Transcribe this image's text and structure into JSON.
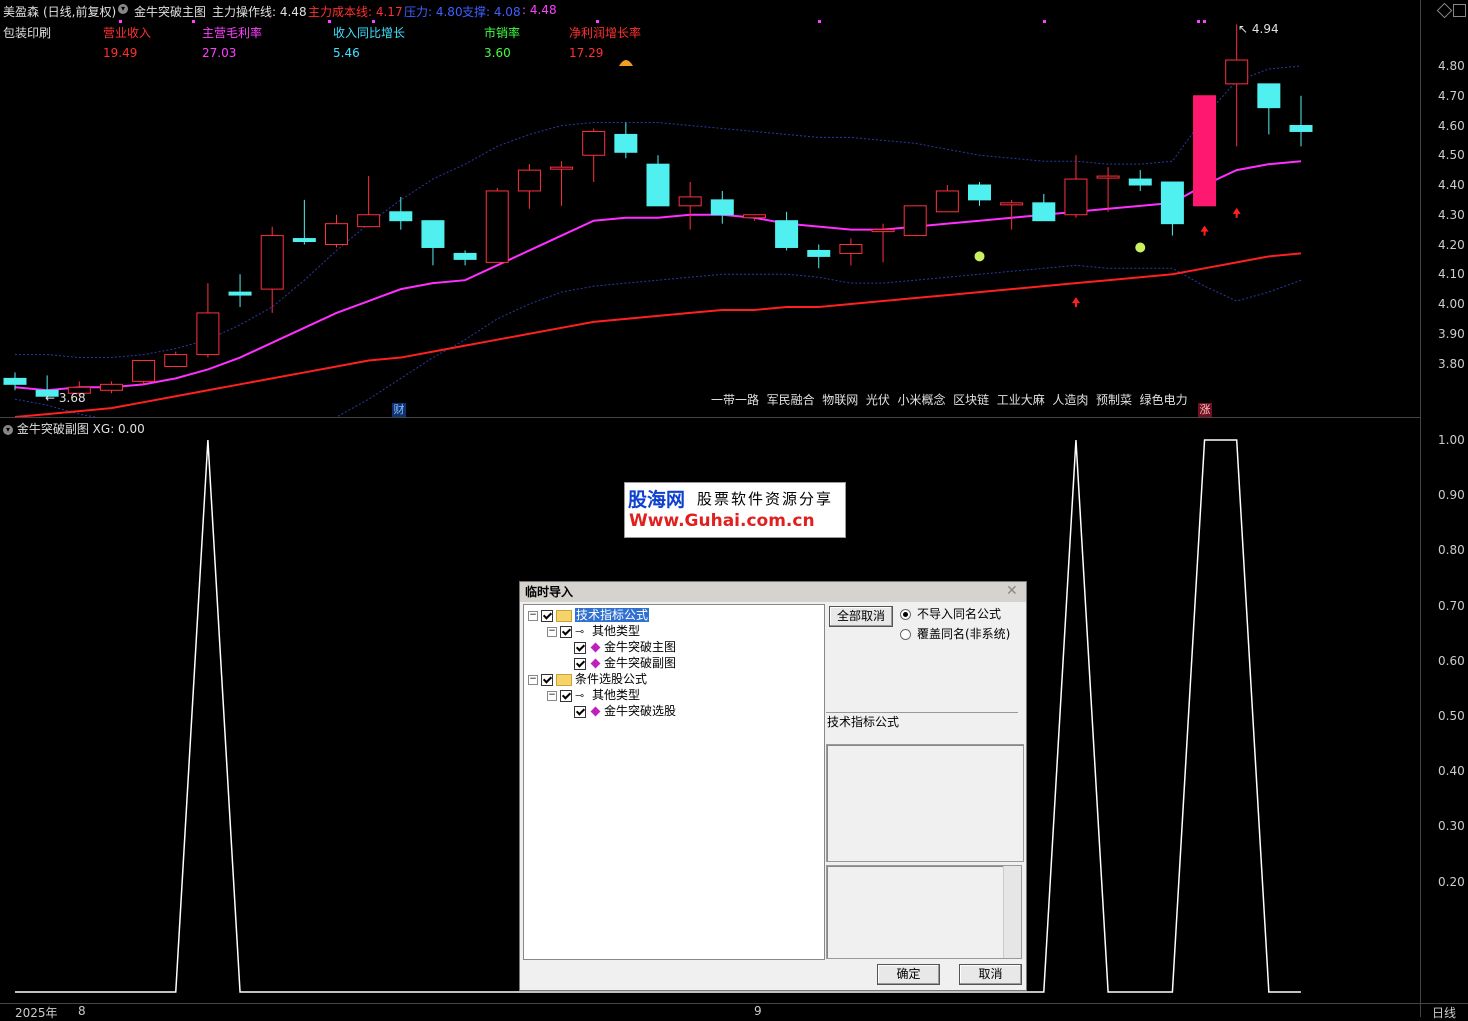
{
  "header": {
    "stock_name": "美盈森",
    "period": "(日线,前复权)",
    "indicator_name": "金牛突破主图",
    "op_line": "主力操作线: 4.48",
    "cost_line": "主力成本线: 4.17",
    "pressure": "压力: 4.80",
    "support": "支撑: 4.08",
    "extra": ": 4.48",
    "colors": {
      "op": "#e0e0e0",
      "cost": "#ff3030",
      "pressure": "#4060ff",
      "support": "#4060ff",
      "extra": "#ff40ff"
    }
  },
  "fundamentals": {
    "industry": "包装印刷",
    "items": [
      {
        "label": "营业收入",
        "value": "19.49",
        "label_color": "#ff3030",
        "value_color": "#ff3030"
      },
      {
        "label": "主营毛利率",
        "value": "27.03",
        "label_color": "#ff40ff",
        "value_color": "#ff40ff"
      },
      {
        "label": "收入同比增长",
        "value": "5.46",
        "label_color": "#40e0ff",
        "value_color": "#40e0ff"
      },
      {
        "label": "市销率",
        "value": "3.60",
        "label_color": "#40ff40",
        "value_color": "#40ff40"
      },
      {
        "label": "净利润增长率",
        "value": "17.29",
        "label_color": "#ff3030",
        "value_color": "#ff3030"
      }
    ]
  },
  "price_axis": [
    "4.80",
    "4.70",
    "4.60",
    "4.50",
    "4.40",
    "4.30",
    "4.20",
    "4.10",
    "4.00",
    "3.90",
    "3.80"
  ],
  "sub_axis": [
    "1.00",
    "0.90",
    "0.80",
    "0.70",
    "0.60",
    "0.50",
    "0.40",
    "0.30",
    "0.20"
  ],
  "annotations": {
    "high": "4.94",
    "low": "3.68",
    "concepts": "一带一路  军民融合  物联网  光伏  小米概念  区块链  工业大麻  人造肉  预制菜  绿色电力",
    "cai_badge": "财",
    "zhang_badge": "涨"
  },
  "sub_header": {
    "title": "金牛突破副图",
    "value": "XG: 0.00"
  },
  "bottom_axis": {
    "year": "2025年",
    "m1": "8",
    "m2": "9",
    "period": "日线"
  },
  "watermark": {
    "line1": "股海网",
    "line2": "股票软件资源分享",
    "url": "Www.Guhai.com.cn"
  },
  "dialog": {
    "title": "临时导入",
    "tree": [
      {
        "label": "技术指标公式",
        "level": 0,
        "type": "folder",
        "selected": true
      },
      {
        "label": "其他类型",
        "level": 1,
        "type": "key"
      },
      {
        "label": "金牛突破主图",
        "level": 2,
        "type": "formula"
      },
      {
        "label": "金牛突破副图",
        "level": 2,
        "type": "formula"
      },
      {
        "label": "条件选股公式",
        "level": 0,
        "type": "folder"
      },
      {
        "label": "其他类型",
        "level": 1,
        "type": "key"
      },
      {
        "label": "金牛突破选股",
        "level": 2,
        "type": "formula"
      }
    ],
    "cancel_all": "全部取消",
    "radio_no_import": "不导入同名公式",
    "radio_overwrite": "覆盖同名(非系统)",
    "detail_label": "技术指标公式",
    "ok": "确定",
    "cancel": "取消"
  },
  "chart_data": {
    "type": "candlestick",
    "price_range": [
      3.7,
      4.96
    ],
    "candles": [
      {
        "o": 3.75,
        "c": 3.73,
        "h": 3.77,
        "l": 3.71
      },
      {
        "o": 3.71,
        "c": 3.69,
        "h": 3.76,
        "l": 3.68
      },
      {
        "o": 3.7,
        "c": 3.72,
        "h": 3.74,
        "l": 3.69
      },
      {
        "o": 3.71,
        "c": 3.73,
        "h": 3.74,
        "l": 3.7
      },
      {
        "o": 3.74,
        "c": 3.81,
        "h": 3.81,
        "l": 3.73
      },
      {
        "o": 3.79,
        "c": 3.83,
        "h": 3.84,
        "l": 3.79
      },
      {
        "o": 3.83,
        "c": 3.97,
        "h": 4.07,
        "l": 3.82
      },
      {
        "o": 4.04,
        "c": 4.03,
        "h": 4.1,
        "l": 3.99
      },
      {
        "o": 4.05,
        "c": 4.23,
        "h": 4.26,
        "l": 3.97
      },
      {
        "o": 4.22,
        "c": 4.21,
        "h": 4.35,
        "l": 4.2
      },
      {
        "o": 4.2,
        "c": 4.27,
        "h": 4.3,
        "l": 4.19
      },
      {
        "o": 4.26,
        "c": 4.3,
        "h": 4.43,
        "l": 4.26
      },
      {
        "o": 4.31,
        "c": 4.28,
        "h": 4.36,
        "l": 4.25
      },
      {
        "o": 4.28,
        "c": 4.19,
        "h": 4.28,
        "l": 4.13
      },
      {
        "o": 4.17,
        "c": 4.15,
        "h": 4.18,
        "l": 4.13
      },
      {
        "o": 4.14,
        "c": 4.38,
        "h": 4.39,
        "l": 4.14
      },
      {
        "o": 4.38,
        "c": 4.45,
        "h": 4.47,
        "l": 4.32
      },
      {
        "o": 4.46,
        "c": 4.46,
        "h": 4.48,
        "l": 4.33
      },
      {
        "o": 4.5,
        "c": 4.58,
        "h": 4.59,
        "l": 4.41
      },
      {
        "o": 4.57,
        "c": 4.51,
        "h": 4.61,
        "l": 4.49
      },
      {
        "o": 4.47,
        "c": 4.33,
        "h": 4.5,
        "l": 4.33
      },
      {
        "o": 4.33,
        "c": 4.36,
        "h": 4.41,
        "l": 4.25
      },
      {
        "o": 4.35,
        "c": 4.3,
        "h": 4.38,
        "l": 4.27
      },
      {
        "o": 4.29,
        "c": 4.3,
        "h": 4.3,
        "l": 4.28
      },
      {
        "o": 4.28,
        "c": 4.19,
        "h": 4.31,
        "l": 4.18
      },
      {
        "o": 4.18,
        "c": 4.16,
        "h": 4.2,
        "l": 4.12
      },
      {
        "o": 4.17,
        "c": 4.2,
        "h": 4.22,
        "l": 4.13
      },
      {
        "o": 4.25,
        "c": 4.25,
        "h": 4.27,
        "l": 4.14
      },
      {
        "o": 4.23,
        "c": 4.33,
        "h": 4.33,
        "l": 4.23
      },
      {
        "o": 4.31,
        "c": 4.38,
        "h": 4.4,
        "l": 4.31
      },
      {
        "o": 4.4,
        "c": 4.35,
        "h": 4.41,
        "l": 4.33
      },
      {
        "o": 4.34,
        "c": 4.34,
        "h": 4.35,
        "l": 4.25
      },
      {
        "o": 4.34,
        "c": 4.28,
        "h": 4.37,
        "l": 4.28
      },
      {
        "o": 4.3,
        "c": 4.42,
        "h": 4.5,
        "l": 4.29
      },
      {
        "o": 4.43,
        "c": 4.43,
        "h": 4.46,
        "l": 4.31
      },
      {
        "o": 4.42,
        "c": 4.4,
        "h": 4.45,
        "l": 4.38
      },
      {
        "o": 4.41,
        "c": 4.27,
        "h": 4.41,
        "l": 4.23
      },
      {
        "o": 4.33,
        "c": 4.7,
        "h": 4.7,
        "l": 4.33
      },
      {
        "o": 4.74,
        "c": 4.82,
        "h": 4.94,
        "l": 4.53
      },
      {
        "o": 4.74,
        "c": 4.66,
        "h": 4.74,
        "l": 4.57
      },
      {
        "o": 4.6,
        "c": 4.58,
        "h": 4.7,
        "l": 4.53
      }
    ],
    "ma_magenta": [
      3.72,
      3.71,
      3.72,
      3.72,
      3.73,
      3.75,
      3.78,
      3.82,
      3.87,
      3.92,
      3.97,
      4.01,
      4.05,
      4.07,
      4.08,
      4.13,
      4.18,
      4.23,
      4.28,
      4.29,
      4.29,
      4.3,
      4.3,
      4.29,
      4.27,
      4.26,
      4.25,
      4.25,
      4.26,
      4.27,
      4.28,
      4.29,
      4.3,
      4.31,
      4.32,
      4.33,
      4.34,
      4.4,
      4.45,
      4.47,
      4.48
    ],
    "cost_line": [
      3.62,
      3.63,
      3.64,
      3.65,
      3.67,
      3.69,
      3.71,
      3.73,
      3.75,
      3.77,
      3.79,
      3.81,
      3.82,
      3.84,
      3.86,
      3.88,
      3.9,
      3.92,
      3.94,
      3.95,
      3.96,
      3.97,
      3.98,
      3.98,
      3.99,
      3.99,
      4.0,
      4.01,
      4.02,
      4.03,
      4.04,
      4.05,
      4.06,
      4.07,
      4.08,
      4.09,
      4.1,
      4.12,
      4.14,
      4.16,
      4.17
    ],
    "upper_band": [
      3.83,
      3.83,
      3.82,
      3.82,
      3.83,
      3.85,
      3.88,
      3.93,
      3.99,
      4.08,
      4.18,
      4.27,
      4.35,
      4.42,
      4.47,
      4.53,
      4.57,
      4.6,
      4.61,
      4.61,
      4.61,
      4.6,
      4.59,
      4.58,
      4.57,
      4.56,
      4.56,
      4.55,
      4.54,
      4.52,
      4.5,
      4.49,
      4.48,
      4.48,
      4.47,
      4.47,
      4.48,
      4.63,
      4.75,
      4.79,
      4.8
    ],
    "lower_band": [
      3.68,
      3.66,
      3.63,
      3.61,
      3.61,
      3.6,
      3.59,
      3.58,
      3.58,
      3.58,
      3.62,
      3.68,
      3.75,
      3.82,
      3.88,
      3.95,
      4.0,
      4.04,
      4.06,
      4.07,
      4.08,
      4.09,
      4.1,
      4.1,
      4.1,
      4.09,
      4.07,
      4.07,
      4.08,
      4.09,
      4.1,
      4.11,
      4.12,
      4.13,
      4.12,
      4.12,
      4.12,
      4.06,
      4.01,
      4.04,
      4.08
    ],
    "xg_signal": [
      0,
      0,
      0,
      0,
      0,
      0,
      1,
      0,
      0,
      0,
      0,
      0,
      0,
      0,
      0,
      0,
      0,
      0,
      0,
      0,
      0,
      0,
      0,
      0,
      0,
      0,
      0,
      0,
      0,
      0,
      0,
      0,
      0,
      1,
      0,
      0,
      0,
      1,
      1,
      0,
      0
    ]
  }
}
